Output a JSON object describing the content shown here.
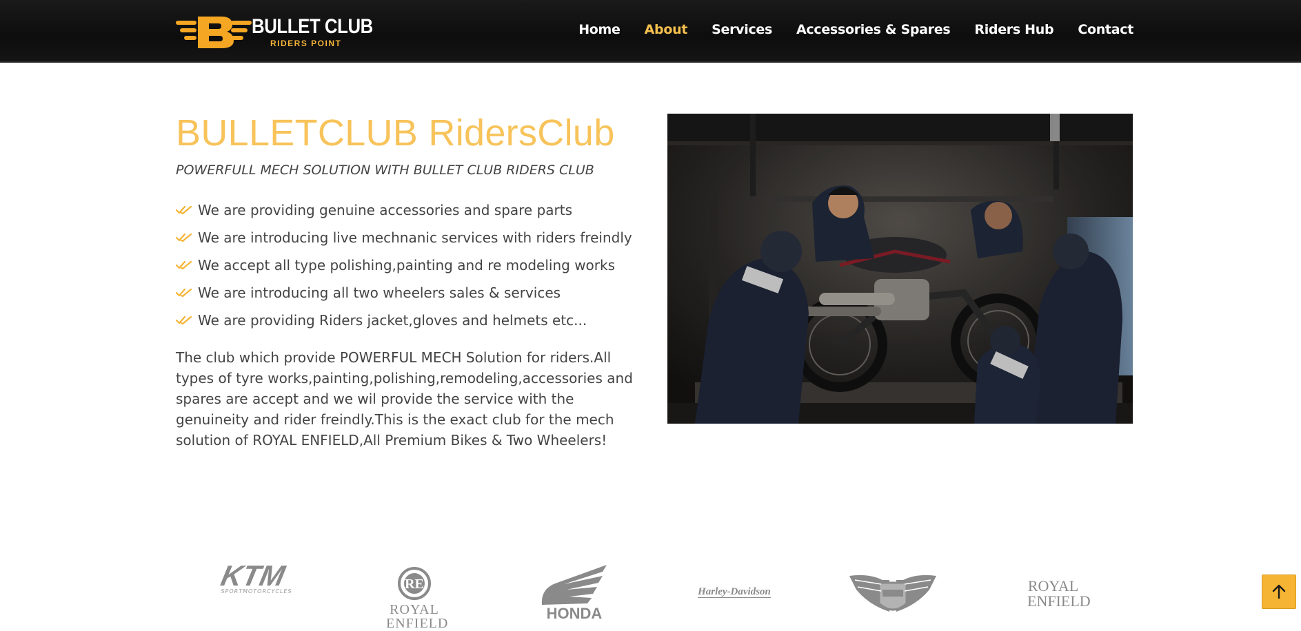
{
  "header": {
    "logo": {
      "title": "BULLET CLUB",
      "subtitle": "RIDERS POINT"
    },
    "nav": [
      {
        "label": "Home",
        "active": false
      },
      {
        "label": "About",
        "active": true
      },
      {
        "label": "Services",
        "active": false
      },
      {
        "label": "Accessories & Spares",
        "active": false
      },
      {
        "label": "Riders Hub",
        "active": false
      },
      {
        "label": "Contact",
        "active": false
      }
    ]
  },
  "about": {
    "title": "BULLETCLUB RidersClub",
    "subtitle": "POWERFULL MECH SOLUTION WITH BULLET CLUB RIDERS CLUB",
    "features": [
      "We are providing genuine accessories and spare parts",
      "We are introducing live mechnanic services with riders freindly",
      "We accept all type polishing,painting and re modeling works",
      "We are introducing all two wheelers sales & services",
      "We are providing Riders jacket,gloves and helmets etc..."
    ],
    "description": "The club which provide POWERFUL MECH Solution for riders.All types of tyre works,painting,polishing,remodeling,accessories and spares are accept and we wil provide the service with the genuineity and rider freindly.This is the exact club for the mech solution of ROYAL ENFIELD,All Premium Bikes & Two Wheelers!"
  },
  "brands": [
    {
      "label": "KTM",
      "tagline": "SPORTMOTORCYCLES"
    },
    {
      "label": "Royal Enfield",
      "top": "ROYAL",
      "bottom": "ENFIELD"
    },
    {
      "label": "HONDA"
    },
    {
      "label": "Harley-Davidson"
    },
    {
      "label": "Harley-Davidson wings emblem"
    },
    {
      "label": "Royal Enfield",
      "top": "ROYAL",
      "bottom": "ENFIELD"
    }
  ],
  "colors": {
    "accent": "#f7c35a",
    "header_bg": "#111111",
    "text": "#444444",
    "brand_grey": "#8a8a8a"
  },
  "icons": {
    "feature_bullet": "double-check-icon",
    "back_to_top": "arrow-up-icon"
  }
}
